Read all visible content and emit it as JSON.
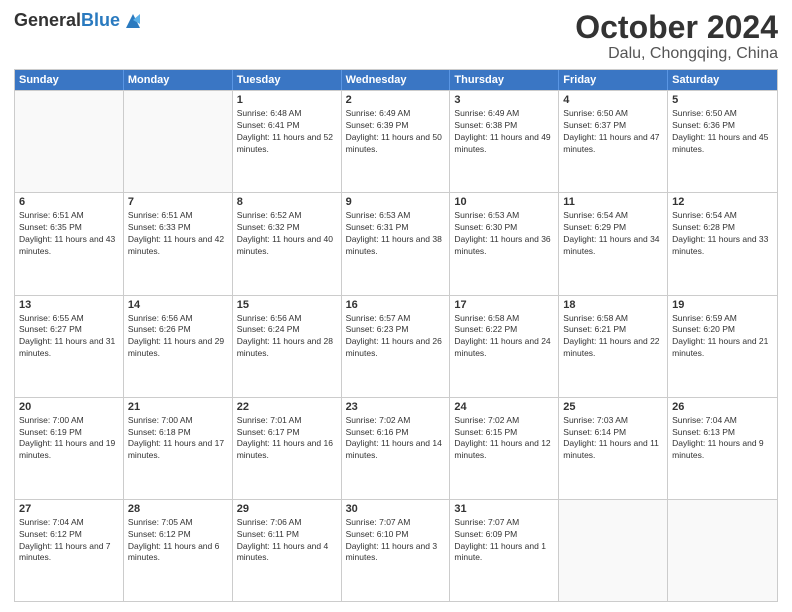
{
  "header": {
    "logo_general": "General",
    "logo_blue": "Blue",
    "month": "October 2024",
    "location": "Dalu, Chongqing, China"
  },
  "weekdays": [
    "Sunday",
    "Monday",
    "Tuesday",
    "Wednesday",
    "Thursday",
    "Friday",
    "Saturday"
  ],
  "rows": [
    [
      {
        "day": "",
        "empty": true
      },
      {
        "day": "",
        "empty": true
      },
      {
        "day": "1",
        "sunrise": "Sunrise: 6:48 AM",
        "sunset": "Sunset: 6:41 PM",
        "daylight": "Daylight: 11 hours and 52 minutes."
      },
      {
        "day": "2",
        "sunrise": "Sunrise: 6:49 AM",
        "sunset": "Sunset: 6:39 PM",
        "daylight": "Daylight: 11 hours and 50 minutes."
      },
      {
        "day": "3",
        "sunrise": "Sunrise: 6:49 AM",
        "sunset": "Sunset: 6:38 PM",
        "daylight": "Daylight: 11 hours and 49 minutes."
      },
      {
        "day": "4",
        "sunrise": "Sunrise: 6:50 AM",
        "sunset": "Sunset: 6:37 PM",
        "daylight": "Daylight: 11 hours and 47 minutes."
      },
      {
        "day": "5",
        "sunrise": "Sunrise: 6:50 AM",
        "sunset": "Sunset: 6:36 PM",
        "daylight": "Daylight: 11 hours and 45 minutes."
      }
    ],
    [
      {
        "day": "6",
        "sunrise": "Sunrise: 6:51 AM",
        "sunset": "Sunset: 6:35 PM",
        "daylight": "Daylight: 11 hours and 43 minutes."
      },
      {
        "day": "7",
        "sunrise": "Sunrise: 6:51 AM",
        "sunset": "Sunset: 6:33 PM",
        "daylight": "Daylight: 11 hours and 42 minutes."
      },
      {
        "day": "8",
        "sunrise": "Sunrise: 6:52 AM",
        "sunset": "Sunset: 6:32 PM",
        "daylight": "Daylight: 11 hours and 40 minutes."
      },
      {
        "day": "9",
        "sunrise": "Sunrise: 6:53 AM",
        "sunset": "Sunset: 6:31 PM",
        "daylight": "Daylight: 11 hours and 38 minutes."
      },
      {
        "day": "10",
        "sunrise": "Sunrise: 6:53 AM",
        "sunset": "Sunset: 6:30 PM",
        "daylight": "Daylight: 11 hours and 36 minutes."
      },
      {
        "day": "11",
        "sunrise": "Sunrise: 6:54 AM",
        "sunset": "Sunset: 6:29 PM",
        "daylight": "Daylight: 11 hours and 34 minutes."
      },
      {
        "day": "12",
        "sunrise": "Sunrise: 6:54 AM",
        "sunset": "Sunset: 6:28 PM",
        "daylight": "Daylight: 11 hours and 33 minutes."
      }
    ],
    [
      {
        "day": "13",
        "sunrise": "Sunrise: 6:55 AM",
        "sunset": "Sunset: 6:27 PM",
        "daylight": "Daylight: 11 hours and 31 minutes."
      },
      {
        "day": "14",
        "sunrise": "Sunrise: 6:56 AM",
        "sunset": "Sunset: 6:26 PM",
        "daylight": "Daylight: 11 hours and 29 minutes."
      },
      {
        "day": "15",
        "sunrise": "Sunrise: 6:56 AM",
        "sunset": "Sunset: 6:24 PM",
        "daylight": "Daylight: 11 hours and 28 minutes."
      },
      {
        "day": "16",
        "sunrise": "Sunrise: 6:57 AM",
        "sunset": "Sunset: 6:23 PM",
        "daylight": "Daylight: 11 hours and 26 minutes."
      },
      {
        "day": "17",
        "sunrise": "Sunrise: 6:58 AM",
        "sunset": "Sunset: 6:22 PM",
        "daylight": "Daylight: 11 hours and 24 minutes."
      },
      {
        "day": "18",
        "sunrise": "Sunrise: 6:58 AM",
        "sunset": "Sunset: 6:21 PM",
        "daylight": "Daylight: 11 hours and 22 minutes."
      },
      {
        "day": "19",
        "sunrise": "Sunrise: 6:59 AM",
        "sunset": "Sunset: 6:20 PM",
        "daylight": "Daylight: 11 hours and 21 minutes."
      }
    ],
    [
      {
        "day": "20",
        "sunrise": "Sunrise: 7:00 AM",
        "sunset": "Sunset: 6:19 PM",
        "daylight": "Daylight: 11 hours and 19 minutes."
      },
      {
        "day": "21",
        "sunrise": "Sunrise: 7:00 AM",
        "sunset": "Sunset: 6:18 PM",
        "daylight": "Daylight: 11 hours and 17 minutes."
      },
      {
        "day": "22",
        "sunrise": "Sunrise: 7:01 AM",
        "sunset": "Sunset: 6:17 PM",
        "daylight": "Daylight: 11 hours and 16 minutes."
      },
      {
        "day": "23",
        "sunrise": "Sunrise: 7:02 AM",
        "sunset": "Sunset: 6:16 PM",
        "daylight": "Daylight: 11 hours and 14 minutes."
      },
      {
        "day": "24",
        "sunrise": "Sunrise: 7:02 AM",
        "sunset": "Sunset: 6:15 PM",
        "daylight": "Daylight: 11 hours and 12 minutes."
      },
      {
        "day": "25",
        "sunrise": "Sunrise: 7:03 AM",
        "sunset": "Sunset: 6:14 PM",
        "daylight": "Daylight: 11 hours and 11 minutes."
      },
      {
        "day": "26",
        "sunrise": "Sunrise: 7:04 AM",
        "sunset": "Sunset: 6:13 PM",
        "daylight": "Daylight: 11 hours and 9 minutes."
      }
    ],
    [
      {
        "day": "27",
        "sunrise": "Sunrise: 7:04 AM",
        "sunset": "Sunset: 6:12 PM",
        "daylight": "Daylight: 11 hours and 7 minutes."
      },
      {
        "day": "28",
        "sunrise": "Sunrise: 7:05 AM",
        "sunset": "Sunset: 6:12 PM",
        "daylight": "Daylight: 11 hours and 6 minutes."
      },
      {
        "day": "29",
        "sunrise": "Sunrise: 7:06 AM",
        "sunset": "Sunset: 6:11 PM",
        "daylight": "Daylight: 11 hours and 4 minutes."
      },
      {
        "day": "30",
        "sunrise": "Sunrise: 7:07 AM",
        "sunset": "Sunset: 6:10 PM",
        "daylight": "Daylight: 11 hours and 3 minutes."
      },
      {
        "day": "31",
        "sunrise": "Sunrise: 7:07 AM",
        "sunset": "Sunset: 6:09 PM",
        "daylight": "Daylight: 11 hours and 1 minute."
      },
      {
        "day": "",
        "empty": true
      },
      {
        "day": "",
        "empty": true
      }
    ]
  ]
}
